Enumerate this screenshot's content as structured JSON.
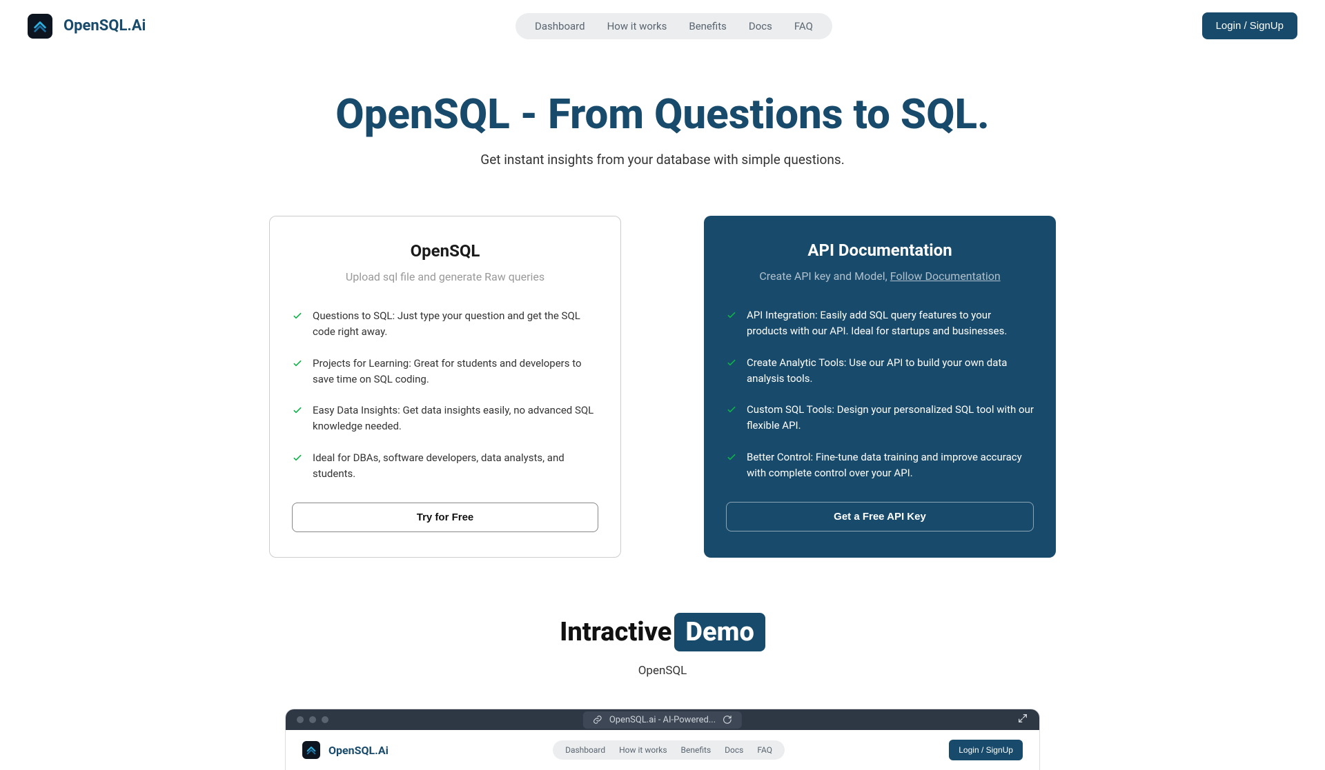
{
  "brand": "OpenSQL.Ai",
  "nav": {
    "items": [
      "Dashboard",
      "How it works",
      "Benefits",
      "Docs",
      "FAQ"
    ]
  },
  "login_label": "Login / SignUp",
  "hero": {
    "title": "OpenSQL - From Questions to SQL.",
    "subtitle": "Get instant insights from your database with simple questions."
  },
  "card_left": {
    "title": "OpenSQL",
    "subtitle": "Upload sql file and generate Raw queries",
    "features": [
      "Questions to SQL: Just type your question and get the SQL code right away.",
      "Projects for Learning: Great for students and developers to save time on SQL coding.",
      "Easy Data Insights: Get data insights easily, no advanced SQL knowledge needed.",
      "Ideal for DBAs, software developers, data analysts, and students."
    ],
    "cta": "Try for Free"
  },
  "card_right": {
    "title": "API Documentation",
    "subtitle_prefix": "Create API key and Model, ",
    "subtitle_link": "Follow Documentation",
    "features": [
      "API Integration: Easily add SQL query features to your products with our API. Ideal for startups and businesses.",
      "Create Analytic Tools: Use our API to build your own data analysis tools.",
      "Custom SQL Tools: Design your personalized SQL tool with our flexible API.",
      "Better Control: Fine-tune data training and improve accuracy with complete control over your API."
    ],
    "cta": "Get a Free API Key"
  },
  "demo": {
    "title_plain": "Intractive",
    "title_box": "Demo",
    "subtitle": "OpenSQL",
    "url_text": "OpenSQL.ai - AI-Powered...",
    "inner_brand": "OpenSQL.Ai",
    "inner_nav": [
      "Dashboard",
      "How it works",
      "Benefits",
      "Docs",
      "FAQ"
    ],
    "inner_login": "Login / SignUp"
  }
}
